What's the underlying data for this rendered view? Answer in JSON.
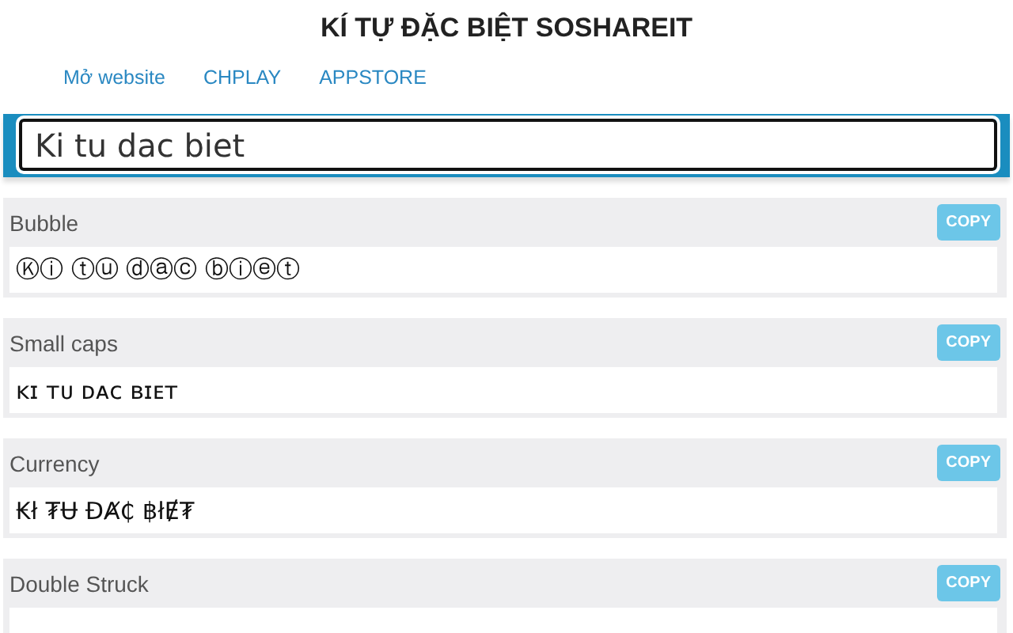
{
  "title": "KÍ TỰ ĐẶC BIỆT SOSHAREIT",
  "nav": [
    "Mở website",
    "CHPLAY",
    "APPSTORE"
  ],
  "input": {
    "value": "Ki tu dac biet"
  },
  "styles": [
    {
      "name": "Bubble",
      "output": "Ⓚⓘ ⓣⓤ ⓓⓐⓒ ⓑⓘⓔⓣ",
      "button": "COPY"
    },
    {
      "name": "Small caps",
      "output": "ᴋɪ ᴛᴜ ᴅᴀᴄ ʙɪᴇᴛ",
      "button": "COPY"
    },
    {
      "name": "Currency",
      "output": "₭ł ₮Ʉ ĐȺ₵ ฿łɆ₮",
      "button": "COPY"
    },
    {
      "name": "Double Struck",
      "button": "COPY"
    }
  ]
}
